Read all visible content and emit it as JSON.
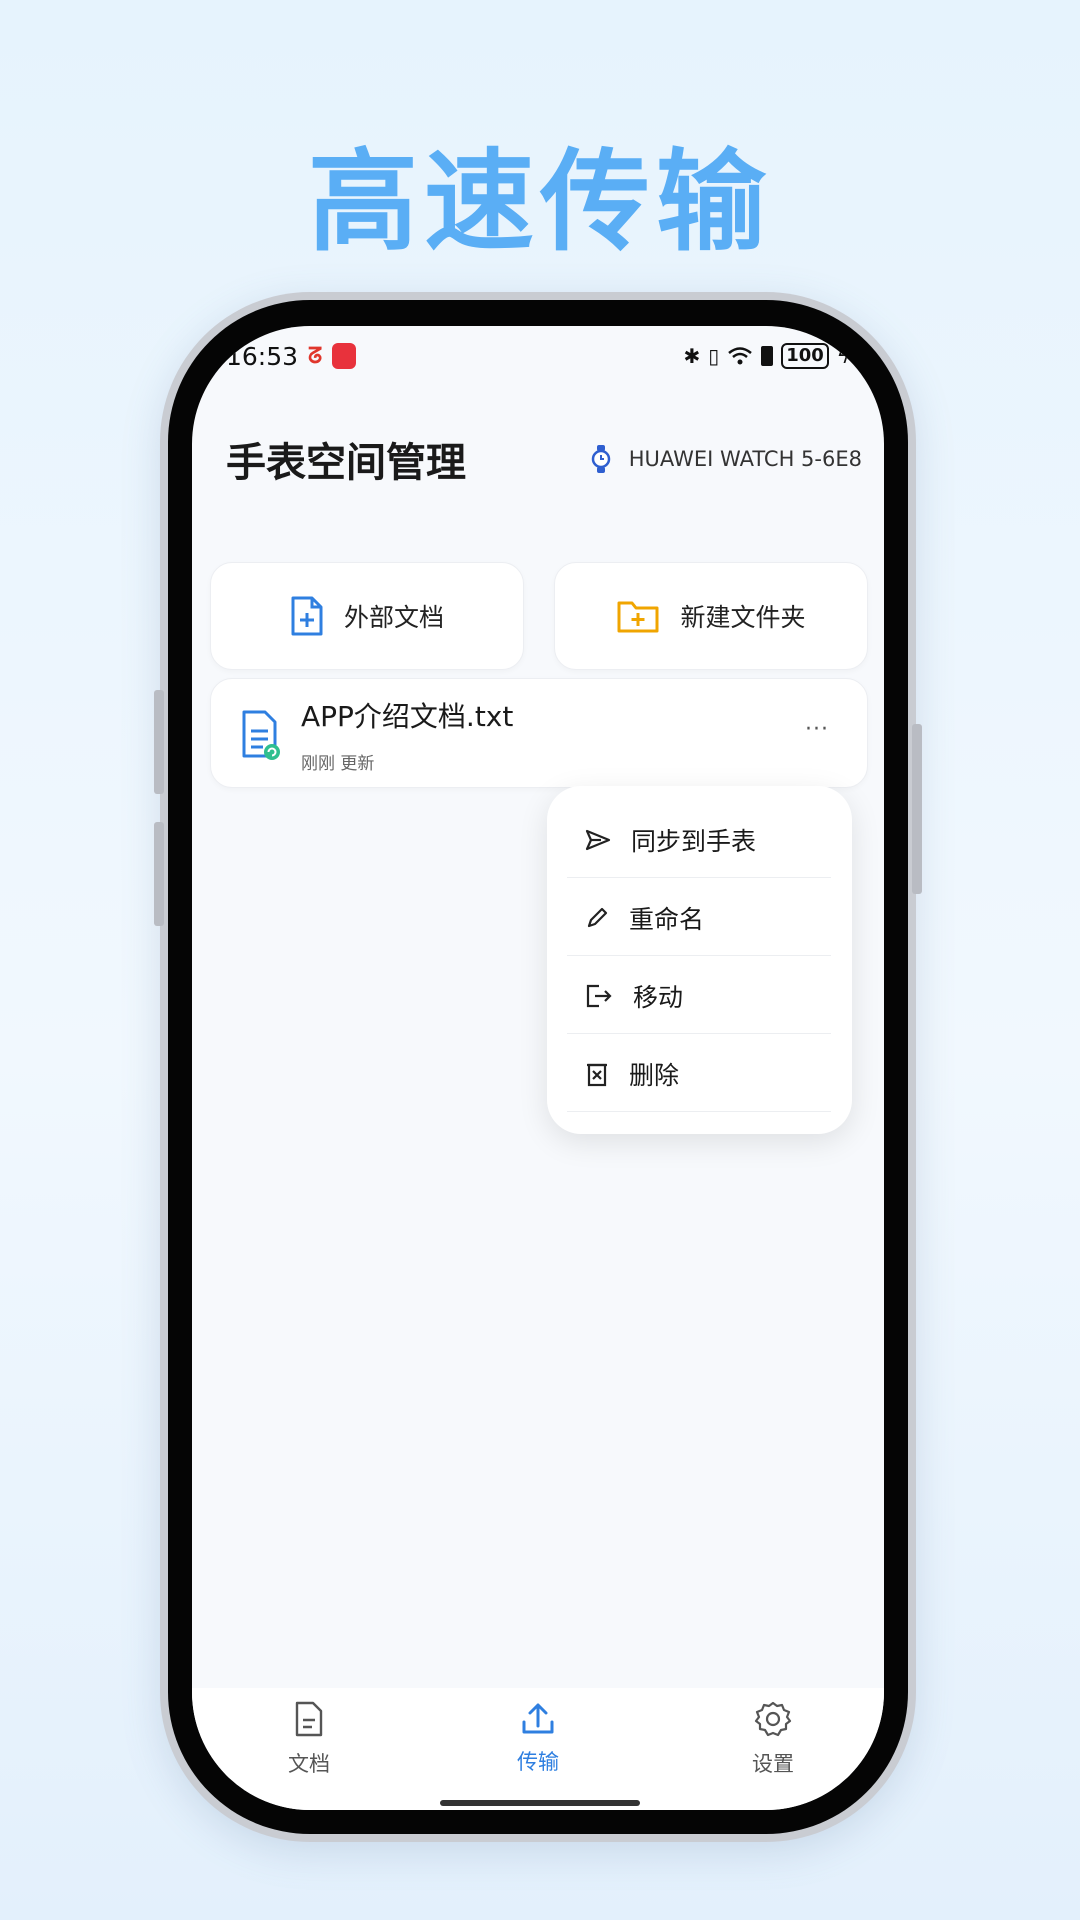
{
  "headline": "高速传输",
  "status_bar": {
    "time": "16:53",
    "battery": "100"
  },
  "app": {
    "title": "手表空间管理",
    "device_name": "HUAWEI WATCH 5-6E8"
  },
  "quick_actions": [
    {
      "label": "外部文档",
      "icon": "add-document-icon",
      "color": "#2f7fe0"
    },
    {
      "label": "新建文件夹",
      "icon": "add-folder-icon",
      "color": "#f0a500"
    }
  ],
  "file": {
    "name": "APP介绍文档.txt",
    "status_time": "刚刚",
    "status_text": "更新",
    "more": "···"
  },
  "context_menu": {
    "items": [
      {
        "label": "同步到手表",
        "icon": "send-icon"
      },
      {
        "label": "重命名",
        "icon": "pencil-icon"
      },
      {
        "label": "移动",
        "icon": "move-icon"
      },
      {
        "label": "删除",
        "icon": "delete-icon"
      }
    ]
  },
  "tabs": [
    {
      "label": "文档",
      "icon": "document-icon",
      "active": false
    },
    {
      "label": "传输",
      "icon": "upload-icon",
      "active": true
    },
    {
      "label": "设置",
      "icon": "gear-icon",
      "active": false
    }
  ],
  "colors": {
    "accent": "#2f7fe0",
    "headline": "#5aaef5",
    "folder": "#f0a500",
    "sync_badge": "#2fbf8f"
  }
}
